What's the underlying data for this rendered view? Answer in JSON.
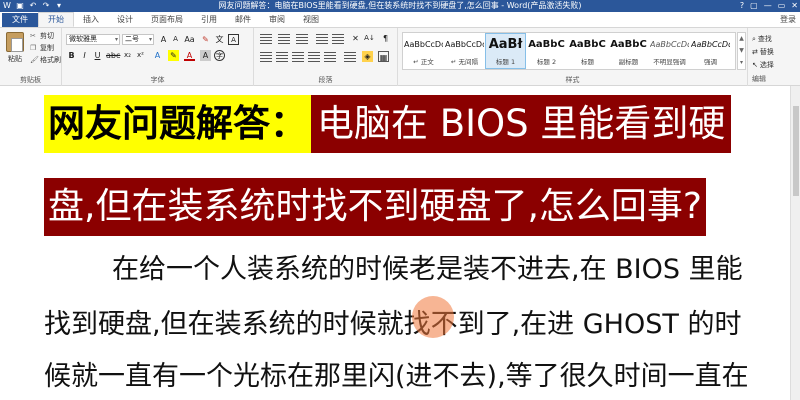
{
  "window": {
    "title": "网友问题解答：电脑在BIOS里能看到硬盘,但在装系统时找不到硬盘了,怎么回事 - Word(产品激活失败)",
    "controls": [
      "?",
      "▢",
      "—",
      "▭",
      "✕"
    ]
  },
  "tabs": [
    "文件",
    "开始",
    "插入",
    "设计",
    "页面布局",
    "引用",
    "邮件",
    "审阅",
    "视图"
  ],
  "active_tab": "开始",
  "account": {
    "login_label": "登录"
  },
  "ribbon": {
    "clipboard": {
      "paste_label": "粘贴",
      "cut_label": "剪切",
      "copy_label": "复制",
      "format_painter_label": "格式刷",
      "group_label": "剪贴板"
    },
    "font": {
      "font_name": "微软雅黑",
      "font_size": "二号",
      "group_label": "字体"
    },
    "paragraph": {
      "group_label": "段落"
    },
    "styles": {
      "group_label": "样式",
      "items": [
        {
          "sample": "AaBbCcDd",
          "name": "↵ 正文"
        },
        {
          "sample": "AaBbCcDd",
          "name": "↵ 无间隔"
        },
        {
          "sample": "AaBł",
          "name": "标题 1"
        },
        {
          "sample": "AaBbC",
          "name": "标题 2"
        },
        {
          "sample": "AaBbC",
          "name": "标题"
        },
        {
          "sample": "AaBbC",
          "name": "副标题"
        },
        {
          "sample": "AaBbCcDd",
          "name": "不明显强调"
        },
        {
          "sample": "AaBbCcDd",
          "name": "强调"
        }
      ]
    },
    "editing": {
      "find_label": "查找",
      "replace_label": "替换",
      "select_label": "选择",
      "group_label": "编辑"
    }
  },
  "document": {
    "heading_part1": "网友问题解答：",
    "heading_part2": "电脑在 BIOS 里能看到硬",
    "heading_line2": "盘,但在装系统时找不到硬盘了,怎么回事?",
    "body_line1": "在给一个人装系统的时候老是装不进去,在 BIOS 里能",
    "body_line2": "找到硬盘,但在装系统的时候就找不到了,在进 GHOST 的时",
    "body_line3": "候就一直有一个光标在那里闪(进不去),等了很久时间一直在"
  },
  "colors": {
    "titlebar": "#2b579a",
    "heading_highlight": "#ffff00",
    "heading_red": "#8b0000"
  }
}
